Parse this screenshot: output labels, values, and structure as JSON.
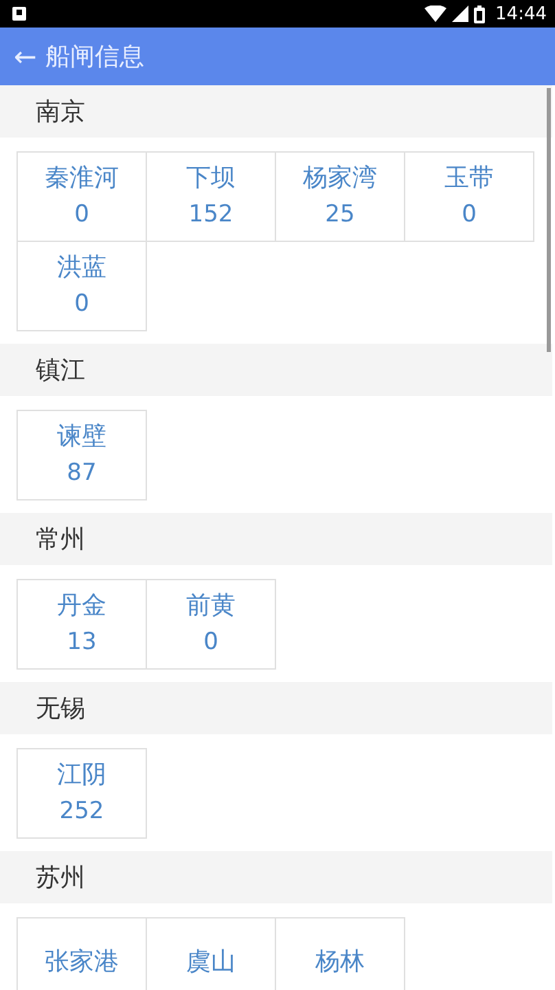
{
  "status_bar": {
    "time": "14:44"
  },
  "app_bar": {
    "back": "←",
    "title": "船闸信息"
  },
  "groups": [
    {
      "city": "南京",
      "locks": [
        {
          "name": "秦淮河",
          "count": "0"
        },
        {
          "name": "下坝",
          "count": "152"
        },
        {
          "name": "杨家湾",
          "count": "25"
        },
        {
          "name": "玉带",
          "count": "0"
        },
        {
          "name": "洪蓝",
          "count": "0"
        }
      ]
    },
    {
      "city": "镇江",
      "locks": [
        {
          "name": "谏壁",
          "count": "87"
        }
      ]
    },
    {
      "city": "常州",
      "locks": [
        {
          "name": "丹金",
          "count": "13"
        },
        {
          "name": "前黄",
          "count": "0"
        }
      ]
    },
    {
      "city": "无锡",
      "locks": [
        {
          "name": "江阴",
          "count": "252"
        }
      ]
    },
    {
      "city": "苏州",
      "locks": [
        {
          "name": "张家港"
        },
        {
          "name": "虞山"
        },
        {
          "name": "杨林"
        }
      ]
    }
  ]
}
